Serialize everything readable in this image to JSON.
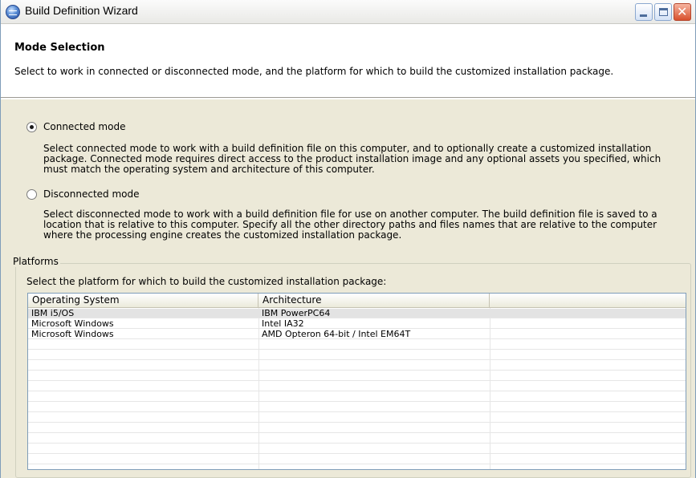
{
  "window": {
    "title": "Build Definition Wizard",
    "close_glyph": "✕"
  },
  "banner": {
    "title": "Mode Selection",
    "description": "Select to work in connected or disconnected mode, and the platform for which to build the customized installation package."
  },
  "modes": {
    "connected": {
      "label": "Connected mode",
      "selected": true,
      "description": "Select connected mode to work with a build definition file on this computer, and to optionally create a customized installation package. Connected mode requires direct access to the product installation image and any optional assets you specified, which must match the operating system and architecture of this computer."
    },
    "disconnected": {
      "label": "Disconnected mode",
      "selected": false,
      "description": "Select disconnected mode to work with a build definition file for use on another computer. The build definition file is saved to a location that is relative to this computer. Specify all the other directory paths and files names that are relative to the computer where the processing engine creates the customized installation package."
    }
  },
  "platforms": {
    "group_label": "Platforms",
    "description": "Select the platform for which to build the customized installation package:",
    "columns": [
      "Operating System",
      "Architecture",
      ""
    ],
    "rows": [
      {
        "os": "IBM i5/OS",
        "arch": "IBM PowerPC64",
        "selected": true
      },
      {
        "os": "Microsoft Windows",
        "arch": "Intel IA32",
        "selected": false
      },
      {
        "os": "Microsoft Windows",
        "arch": "AMD Opteron 64-bit / Intel EM64T",
        "selected": false
      }
    ]
  },
  "colors": {
    "dialog_background": "#ece9d8",
    "selected_row": "#e3e3e3",
    "table_border": "#7f9db9"
  },
  "icons": {
    "app": "wizard-globe-icon",
    "minimize": "minimize-icon",
    "maximize": "maximize-icon",
    "close": "close-icon"
  }
}
